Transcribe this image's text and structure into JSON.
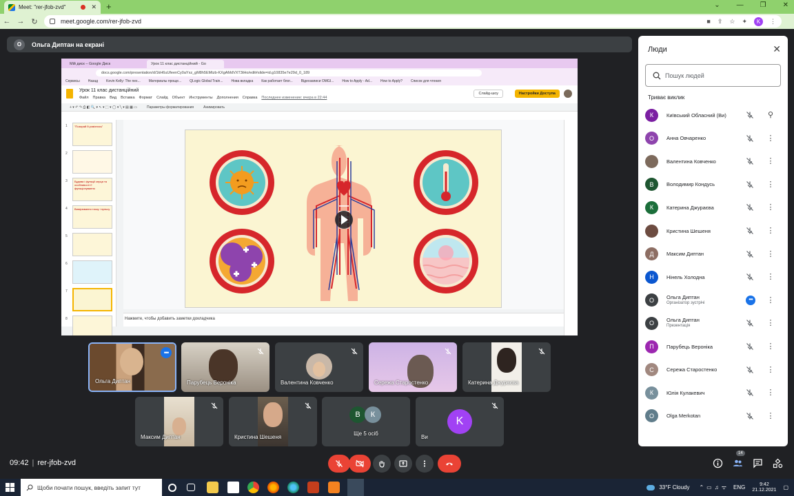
{
  "browser": {
    "tab_title": "Meet: \"rer-jfob-zvd\"",
    "url": "meet.google.com/rer-jfob-zvd",
    "profile_initial": "K"
  },
  "presenter_banner": {
    "icon_letter": "O",
    "text": "Ольга Диптан на екрані"
  },
  "shared_screen": {
    "tabs": [
      "Мій диск – Google Диск",
      "Урок 11 клас дистанційний - Go"
    ],
    "url": "docs.google.com/presentation/d/1kH6uUfeenCy0aYxz_gM8h5EMtzb-KXgAMdVXT3tHo/edit#slide=id.g10835e7e29d_0_189",
    "bookmarks": [
      "Сервисы",
      "Назад",
      "Kevin Kelly: The nex...",
      "Материалы проще...",
      "QLogic Global Train...",
      "Нова вкладка",
      "Как работает блог...",
      "Відеозаписи OMGI...",
      "How to Apply - Ad...",
      "How to Apply?",
      "Список для чтения"
    ],
    "doc_title": "Урок 11 клас дистанційний",
    "menu": [
      "Файл",
      "Правка",
      "Вид",
      "Вставка",
      "Формат",
      "Слайд",
      "Объект",
      "Инструменты",
      "Дополнения",
      "Справка"
    ],
    "last_edit": "Последнее изменение: вчера в 22:44",
    "slideshow_btn": "Слайд-шоу",
    "share_btn": "Настройки Доступа",
    "toolbar_items": [
      "Параметры форматирования",
      "Анимировать"
    ],
    "thumb_texts": [
      "\"Позирай й усміхнись\"",
      "",
      "Будова і функції серця та особливості її функціонування",
      "Вимірювання тиску і пульсу",
      "",
      "",
      "",
      ""
    ],
    "thumb_numbers": [
      "1",
      "2",
      "3",
      "4",
      "5",
      "6",
      "7",
      "8"
    ],
    "notes_placeholder": "Нажмите, чтобы добавить заметки докладчика"
  },
  "tiles": [
    {
      "name": "Ольга Диптан"
    },
    {
      "name": "Парубець Вероніка"
    },
    {
      "name": "Валентина Ковченко"
    },
    {
      "name": "Сережа Старостенко"
    },
    {
      "name": "Катерина Джураєва"
    },
    {
      "name": "Максим Диптан"
    },
    {
      "name": "Кристина Шешеня"
    },
    {
      "name": "Ще 5 осіб",
      "avatars": [
        "В",
        "К"
      ]
    },
    {
      "name": "Ви",
      "letter": "K"
    }
  ],
  "bottom_bar": {
    "time": "09:42",
    "meeting_code": "rer-jfob-zvd",
    "people_count": "14"
  },
  "people_panel": {
    "title": "Люди",
    "search_placeholder": "Пошук людей",
    "section": "Триває виклик",
    "participants": [
      {
        "name": "Київський Обласний (Ви)",
        "letter": "К",
        "color": "#7b1fa2"
      },
      {
        "name": "Анна Овчаренко",
        "letter": "О",
        "color": "#8e44ad"
      },
      {
        "name": "Валентина Ковченко",
        "letter": "",
        "color": "#7d6a5c"
      },
      {
        "name": "Володимир Кондусь",
        "letter": "В",
        "color": "#1e5631"
      },
      {
        "name": "Катерина Джураєва",
        "letter": "К",
        "color": "#1b6e3a"
      },
      {
        "name": "Кристина Шешеня",
        "letter": "",
        "color": "#6d4c41"
      },
      {
        "name": "Максим Диптан",
        "letter": "Д",
        "color": "#8d6e63"
      },
      {
        "name": "Нінель Холодна",
        "letter": "Н",
        "color": "#0b57d0"
      },
      {
        "name": "Ольга Диптан",
        "sub": "Організатор зустрічі",
        "letter": "О",
        "color": "#3c4043"
      },
      {
        "name": "Ольга Диптан",
        "sub": "Презентація",
        "letter": "О",
        "color": "#3c4043"
      },
      {
        "name": "Парубець Вероніка",
        "letter": "П",
        "color": "#9c27b0"
      },
      {
        "name": "Сережа Старостенко",
        "letter": "С",
        "color": "#a1887f"
      },
      {
        "name": "Юлія Кулакевич",
        "letter": "К",
        "color": "#78909c"
      },
      {
        "name": "Olga Merkotan",
        "letter": "O",
        "color": "#607d8b"
      }
    ]
  },
  "taskbar": {
    "search_placeholder": "Щоби почати пошук, введіть запит тут",
    "weather": "33°F Cloudy",
    "lang": "ENG",
    "time": "9:42",
    "date": "21.12.2021"
  }
}
